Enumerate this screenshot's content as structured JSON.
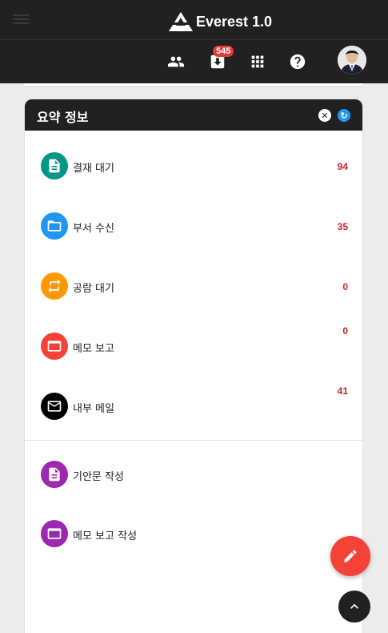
{
  "app": {
    "title": "Everest 1.0"
  },
  "toolbar": {
    "notification_count": "545"
  },
  "card": {
    "title": "요약 정보",
    "close_glyph": "✕",
    "refresh_glyph": "↻",
    "items": [
      {
        "label": "결재 대기",
        "count": "94",
        "icon": "document-icon",
        "color": "#009688"
      },
      {
        "label": "부서 수신",
        "count": "35",
        "icon": "folder-icon",
        "color": "#2196f3"
      },
      {
        "label": "공람 대기",
        "count": "0",
        "icon": "repeat-icon",
        "color": "#ff9800"
      },
      {
        "label": "메모 보고",
        "count": "0",
        "icon": "memo-icon",
        "color": "#f44336"
      },
      {
        "label": "내부 메일",
        "count": "41",
        "icon": "mail-icon",
        "color": "#000000"
      }
    ],
    "actions": [
      {
        "label": "기안문 작성",
        "icon": "document-icon",
        "color": "#9c27b0"
      },
      {
        "label": "메모 보고 작성",
        "icon": "memo-icon",
        "color": "#9c27b0"
      }
    ]
  }
}
